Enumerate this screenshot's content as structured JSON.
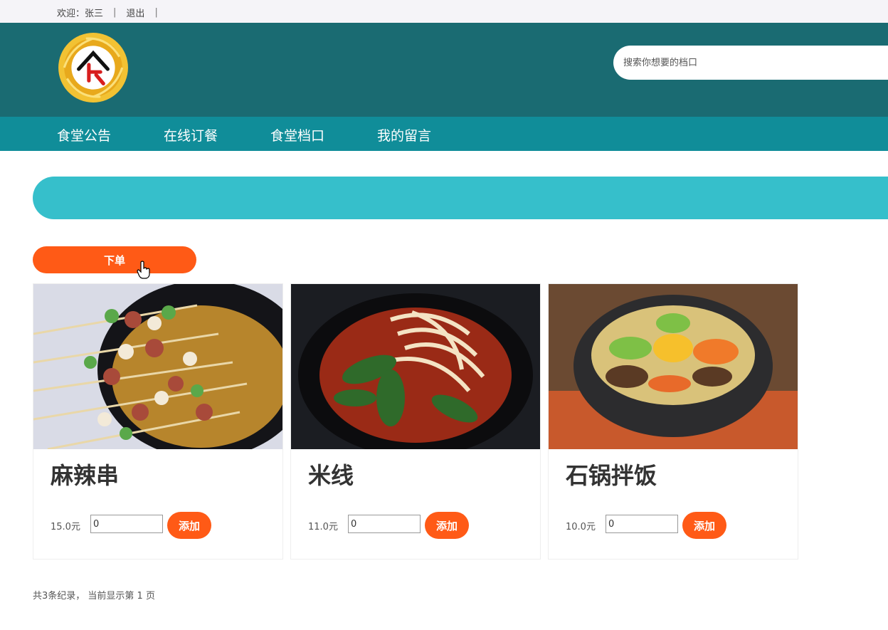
{
  "topbar": {
    "welcome_label": "欢迎：",
    "username": "张三",
    "separator": "|",
    "logout_label": "退出"
  },
  "header": {
    "search_placeholder": "搜索你想要的档口",
    "logo_icon": "canteen-logo-icon"
  },
  "nav": {
    "items": [
      {
        "label": "食堂公告"
      },
      {
        "label": "在线订餐"
      },
      {
        "label": "食堂档口"
      },
      {
        "label": "我的留言"
      }
    ]
  },
  "order": {
    "button_label": "下单"
  },
  "dishes": [
    {
      "name": "麻辣串",
      "price": "15.0元",
      "quantity": "0",
      "add_label": "添加"
    },
    {
      "name": "米线",
      "price": "11.0元",
      "quantity": "0",
      "add_label": "添加"
    },
    {
      "name": "石锅拌饭",
      "price": "10.0元",
      "quantity": "0",
      "add_label": "添加"
    }
  ],
  "pagination": {
    "summary": "共3条纪录，  当前显示第 1 页"
  },
  "colors": {
    "header_bg": "#1a6b72",
    "nav_bg": "#108d99",
    "banner_bg": "#36bfcb",
    "accent_orange": "#ff5a16"
  }
}
